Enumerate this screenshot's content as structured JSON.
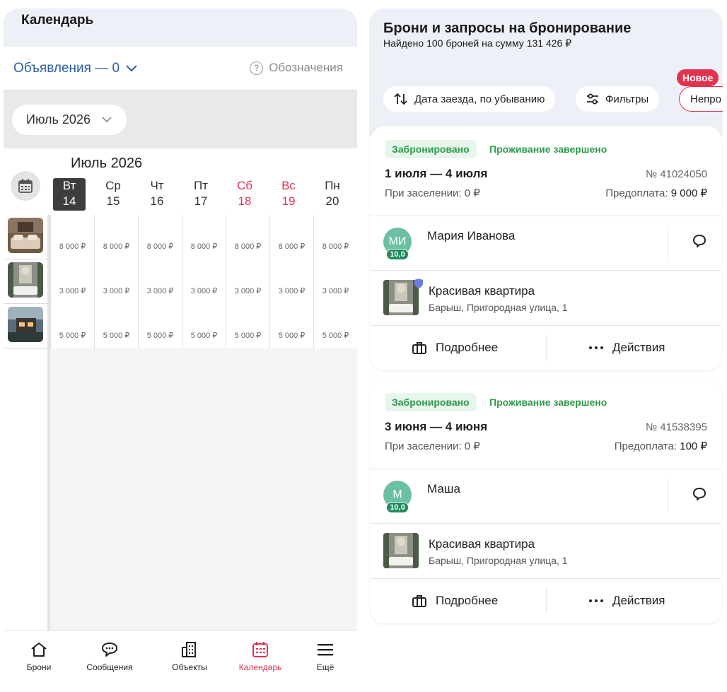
{
  "left": {
    "title": "Календарь",
    "ads_label": "Объявления — 0",
    "legend_label": "Обозначения",
    "legend_icon": "?",
    "month_select": "Июль 2026",
    "month_title": "Июль 2026",
    "days": [
      {
        "dow": "Вт",
        "date": "14"
      },
      {
        "dow": "Ср",
        "date": "15"
      },
      {
        "dow": "Чт",
        "date": "16"
      },
      {
        "dow": "Пт",
        "date": "17"
      },
      {
        "dow": "Сб",
        "date": "18"
      },
      {
        "dow": "Вс",
        "date": "19"
      },
      {
        "dow": "Пн",
        "date": "20"
      }
    ],
    "rows": [
      {
        "price": "8 000 ₽"
      },
      {
        "price": "3 000 ₽"
      },
      {
        "price": "5 000 ₽"
      }
    ]
  },
  "nav": [
    {
      "label": "Брони",
      "icon": "home-icon"
    },
    {
      "label": "Сообщения",
      "icon": "messages-icon"
    },
    {
      "label": "Объекты",
      "icon": "buildings-icon"
    },
    {
      "label": "Календарь",
      "icon": "calendar-icon"
    },
    {
      "label": "Ещё",
      "icon": "menu-icon"
    }
  ],
  "right": {
    "title": "Брони и запросы на бронирование",
    "subtitle": "Найдено 100 броней на сумму 131 426 ₽",
    "sort_chip": "Дата заезда, по убыванию",
    "filters_chip": "Фильтры",
    "unread_chip": "Непро",
    "new_badge": "Новое",
    "cards": [
      {
        "status_booked": "Забронировано",
        "status_done": "Проживание завершено",
        "dates": "1 июля — 4 июля",
        "number": "№ 41024050",
        "checkin": "При заселении: 0 ₽",
        "prepay_label": "Предоплата:",
        "prepay_value": "9 000 ₽",
        "initials": "МИ",
        "rating": "10,0",
        "guest": "Мария Иванова",
        "property": "Красивая квартира",
        "address": "Барыш, Пригородная улица, 1",
        "details": "Подробнее",
        "actions": "Действия"
      },
      {
        "status_booked": "Забронировано",
        "status_done": "Проживание завершено",
        "dates": "3 июня — 4 июня",
        "number": "№ 41538395",
        "checkin": "При заселении: 0 ₽",
        "prepay_label": "Предоплата:",
        "prepay_value": "100 ₽",
        "initials": "М",
        "rating": "10,0",
        "guest": "Маша",
        "property": "Красивая квартира",
        "address": "Барыш, Пригородная улица, 1",
        "details": "Подробнее",
        "actions": "Действия"
      }
    ]
  },
  "colors": {
    "accent": "#e3324f",
    "link": "#2c5fa8",
    "success": "#2e9a4c",
    "header_bg": "#eef0f8"
  }
}
